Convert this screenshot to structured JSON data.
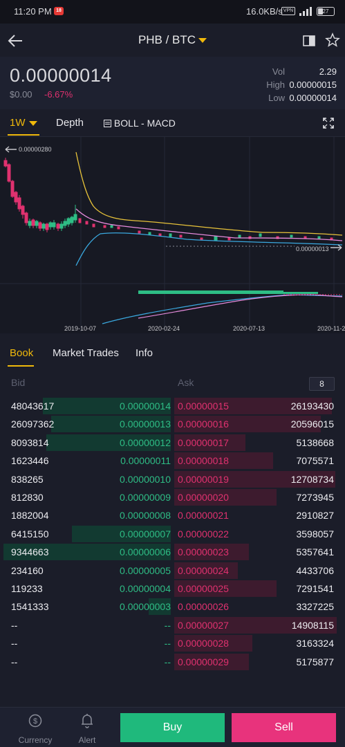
{
  "status_bar": {
    "time": "11:20 PM",
    "notification_badge": "18",
    "network_speed": "16.0KB/s",
    "vpn_label": "VPN",
    "battery": "27"
  },
  "header": {
    "pair": "PHB / BTC"
  },
  "ticker": {
    "price": "0.00000014",
    "fiat": "$0.00",
    "change": "-6.67%",
    "vol_label": "Vol",
    "vol_value": "2.29",
    "high_label": "High",
    "high_value": "0.00000015",
    "low_label": "Low",
    "low_value": "0.00000014"
  },
  "chart_tabs": {
    "interval": "1W",
    "depth": "Depth",
    "indicators": "BOLL - MACD"
  },
  "chart": {
    "max_marker": "0.00000280",
    "last_marker": "0.00000013",
    "dates": [
      "2019-10-07",
      "2020-02-24",
      "2020-07-13",
      "2020-11-2"
    ]
  },
  "book_tabs": {
    "book": "Book",
    "market_trades": "Market Trades",
    "info": "Info"
  },
  "book_head": {
    "bid": "Bid",
    "ask": "Ask",
    "precision": "8"
  },
  "order_book": [
    {
      "bid_qty": "48043617",
      "bid_price": "0.00000014",
      "ask_price": "0.00000015",
      "ask_qty": "26193430",
      "bid_depth": 0.75,
      "ask_depth": 0.97
    },
    {
      "bid_qty": "26097362",
      "bid_price": "0.00000013",
      "ask_price": "0.00000016",
      "ask_qty": "20596015",
      "bid_depth": 0.7,
      "ask_depth": 0.9
    },
    {
      "bid_qty": "8093814",
      "bid_price": "0.00000012",
      "ask_price": "0.00000017",
      "ask_qty": "5138668",
      "bid_depth": 0.73,
      "ask_depth": 0.44
    },
    {
      "bid_qty": "1623446",
      "bid_price": "0.00000011",
      "ask_price": "0.00000018",
      "ask_qty": "7075571",
      "bid_depth": 0.0,
      "ask_depth": 0.61
    },
    {
      "bid_qty": "838265",
      "bid_price": "0.00000010",
      "ask_price": "0.00000019",
      "ask_qty": "12708734",
      "bid_depth": 0.0,
      "ask_depth": 0.99
    },
    {
      "bid_qty": "812830",
      "bid_price": "0.00000009",
      "ask_price": "0.00000020",
      "ask_qty": "7273945",
      "bid_depth": 0.0,
      "ask_depth": 0.63
    },
    {
      "bid_qty": "1882004",
      "bid_price": "0.00000008",
      "ask_price": "0.00000021",
      "ask_qty": "2910827",
      "bid_depth": 0.0,
      "ask_depth": 0.0
    },
    {
      "bid_qty": "6415150",
      "bid_price": "0.00000007",
      "ask_price": "0.00000022",
      "ask_qty": "3598057",
      "bid_depth": 0.58,
      "ask_depth": 0.0
    },
    {
      "bid_qty": "9344663",
      "bid_price": "0.00000006",
      "ask_price": "0.00000023",
      "ask_qty": "5357641",
      "bid_depth": 0.98,
      "ask_depth": 0.46
    },
    {
      "bid_qty": "234160",
      "bid_price": "0.00000005",
      "ask_price": "0.00000024",
      "ask_qty": "4433706",
      "bid_depth": 0.0,
      "ask_depth": 0.39
    },
    {
      "bid_qty": "119233",
      "bid_price": "0.00000004",
      "ask_price": "0.00000025",
      "ask_qty": "7291541",
      "bid_depth": 0.0,
      "ask_depth": 0.63
    },
    {
      "bid_qty": "1541333",
      "bid_price": "0.00000003",
      "ask_price": "0.00000026",
      "ask_qty": "3327225",
      "bid_depth": 0.13,
      "ask_depth": 0.0
    },
    {
      "bid_qty": "--",
      "bid_price": "--",
      "ask_price": "0.00000027",
      "ask_qty": "14908115",
      "bid_depth": 0.0,
      "ask_depth": 1.0
    },
    {
      "bid_qty": "--",
      "bid_price": "--",
      "ask_price": "0.00000028",
      "ask_qty": "3163324",
      "bid_depth": 0.0,
      "ask_depth": 0.48
    },
    {
      "bid_qty": "--",
      "bid_price": "--",
      "ask_price": "0.00000029",
      "ask_qty": "5175877",
      "bid_depth": 0.0,
      "ask_depth": 0.46
    }
  ],
  "bottom_bar": {
    "currency": "Currency",
    "alert": "Alert",
    "buy": "Buy",
    "sell": "Sell"
  },
  "colors": {
    "accent": "#f0b90b",
    "buy_green": "#2ebd85",
    "sell_pink": "#e0316f",
    "buy_button": "#1fb97c",
    "sell_button": "#e8337c"
  }
}
